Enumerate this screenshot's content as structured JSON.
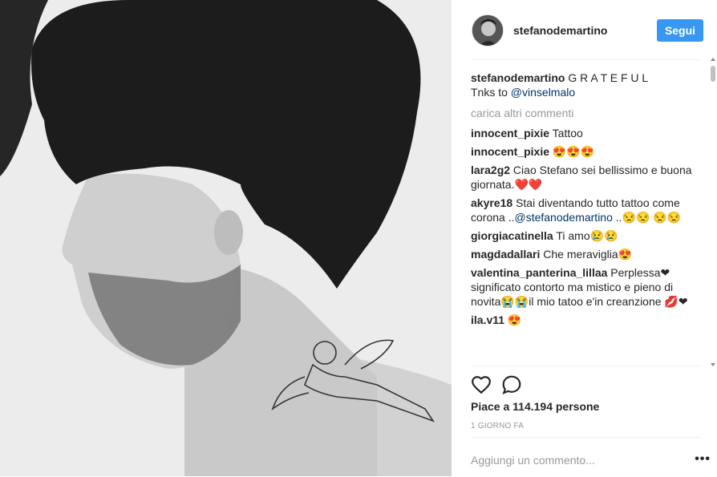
{
  "header": {
    "username": "stefanodemartino",
    "follow_label": "Segui"
  },
  "caption": {
    "username": "stefanodemartino",
    "text": " G R A T E F U L",
    "line2": "Tnks to ",
    "mention": "@vinselmalo"
  },
  "load_more_label": "carica altri commenti",
  "comments": [
    {
      "user": "innocent_pixie",
      "text": " Tattoo"
    },
    {
      "user": "innocent_pixie",
      "text": " 😍😍😍"
    },
    {
      "user": "lara2g2",
      "text": " Ciao Stefano sei bellissimo e buona giornata.❤️❤️"
    },
    {
      "user": "akyre18",
      "text": " Stai diventando tutto tattoo come corona ..",
      "mention": "@stefanodemartino",
      "after": " ..😒😒 😒😒"
    },
    {
      "user": "giorgiacatinella",
      "text": " Ti amo😢😢"
    },
    {
      "user": "magdadallari",
      "text": " Che meraviglia😍"
    },
    {
      "user": "valentina_panterina_lillaa",
      "text": " Perplessa❤ significato contorto ma mistico e pieno di novita😭😭il mio tatoo e'in creanzione 💋❤"
    },
    {
      "user": "ila.v11",
      "text": " 😍"
    }
  ],
  "likes_text": "Piace a 114.194 persone",
  "timestamp": "1 GIORNO FA",
  "add_comment_placeholder": "Aggiungi un commento...",
  "more_label": "•••",
  "colors": {
    "accent": "#3897f0",
    "mention": "#003569",
    "muted": "#999999"
  }
}
